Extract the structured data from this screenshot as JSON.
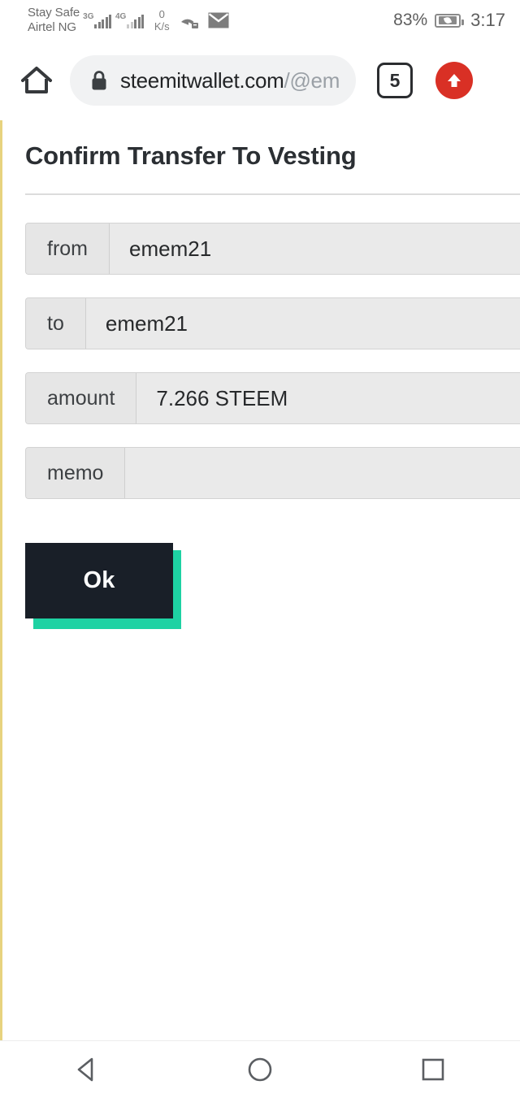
{
  "status_bar": {
    "carrier_line1": "Stay Safe",
    "carrier_line2": "Airtel NG",
    "sim1_network": "3G",
    "sim2_network": "4G",
    "net_speed_value": "0",
    "net_speed_unit": "K/s",
    "missed_call_icon": "missed-call-icon",
    "mail_icon": "mail-icon",
    "battery_percent": "83%",
    "battery_icon": "battery-saver-icon",
    "time": "3:17"
  },
  "browser": {
    "home_icon": "home-icon",
    "lock_icon": "lock-icon",
    "url_host": "steemitwallet.com",
    "url_path": "/@em",
    "tab_count": "5",
    "upload_icon": "upload-arrow-icon",
    "accent_red": "#d93025"
  },
  "page": {
    "title": "Confirm Transfer To Vesting",
    "left_border_color": "#e7d37f",
    "fields": [
      {
        "label": "from",
        "value": "emem21"
      },
      {
        "label": "to",
        "value": "emem21"
      },
      {
        "label": "amount",
        "value": "7.266 STEEM"
      },
      {
        "label": "memo",
        "value": ""
      }
    ],
    "ok_button": {
      "label": "Ok",
      "background": "#191f28",
      "shadow_color": "#1ed2a3",
      "text_color": "#ffffff"
    }
  },
  "nav_bar": {
    "back_icon": "back-triangle-icon",
    "home_icon": "home-circle-icon",
    "recents_icon": "recents-square-icon"
  }
}
